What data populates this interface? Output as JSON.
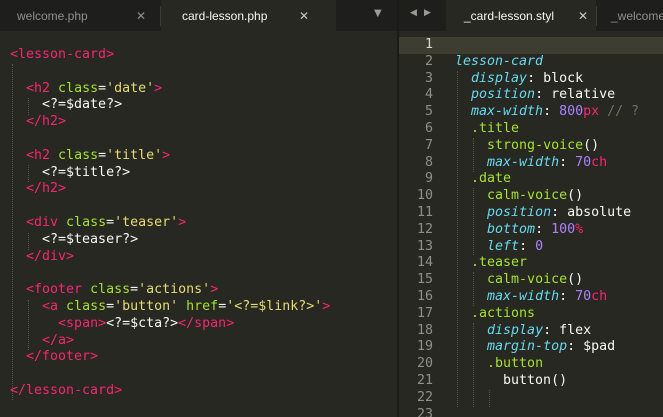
{
  "left_group": {
    "tabs": [
      {
        "label": "welcome.php",
        "close": "✕",
        "active": false
      },
      {
        "label": "card-lesson.php",
        "close": "✕",
        "active": true
      }
    ],
    "dropdown_glyph": "▼"
  },
  "right_group": {
    "nav_prev": "◀",
    "nav_next": "▶",
    "tabs": [
      {
        "label": "_card-lesson.styl",
        "close": "✕",
        "active": true
      },
      {
        "label": "_welcome",
        "active": false
      }
    ]
  },
  "colors": {
    "background": "#272822",
    "tab_bar": "#1e1f1c",
    "tag": "#f92672",
    "attribute": "#a6e22e",
    "string": "#e6db74",
    "property": "#66d9ef",
    "number": "#ae81ff",
    "comment": "#75715e",
    "text": "#f8f8f2"
  },
  "php_editor": {
    "lines": [
      [
        {
          "t": "<lesson-card>",
          "c": "tag"
        }
      ],
      [],
      [
        {
          "t": "  "
        },
        {
          "t": "<h2",
          "c": "tag"
        },
        {
          "t": " class",
          "c": "attr"
        },
        {
          "t": "="
        },
        {
          "t": "'date'",
          "c": "str"
        },
        {
          "t": ">",
          "c": "tag"
        }
      ],
      [
        {
          "t": "    <?=$date?>"
        }
      ],
      [
        {
          "t": "  "
        },
        {
          "t": "</h2>",
          "c": "tag"
        }
      ],
      [],
      [
        {
          "t": "  "
        },
        {
          "t": "<h2",
          "c": "tag"
        },
        {
          "t": " class",
          "c": "attr"
        },
        {
          "t": "="
        },
        {
          "t": "'title'",
          "c": "str"
        },
        {
          "t": ">",
          "c": "tag"
        }
      ],
      [
        {
          "t": "    <?=$title?>"
        }
      ],
      [
        {
          "t": "  "
        },
        {
          "t": "</h2>",
          "c": "tag"
        }
      ],
      [],
      [
        {
          "t": "  "
        },
        {
          "t": "<div",
          "c": "tag"
        },
        {
          "t": " class",
          "c": "attr"
        },
        {
          "t": "="
        },
        {
          "t": "'teaser'",
          "c": "str"
        },
        {
          "t": ">",
          "c": "tag"
        }
      ],
      [
        {
          "t": "    <?=$teaser?>"
        }
      ],
      [
        {
          "t": "  "
        },
        {
          "t": "</div>",
          "c": "tag"
        }
      ],
      [],
      [
        {
          "t": "  "
        },
        {
          "t": "<footer",
          "c": "tag"
        },
        {
          "t": " class",
          "c": "attr"
        },
        {
          "t": "="
        },
        {
          "t": "'actions'",
          "c": "str"
        },
        {
          "t": ">",
          "c": "tag"
        }
      ],
      [
        {
          "t": "    "
        },
        {
          "t": "<a",
          "c": "tag"
        },
        {
          "t": " class",
          "c": "attr"
        },
        {
          "t": "="
        },
        {
          "t": "'button'",
          "c": "str"
        },
        {
          "t": " href",
          "c": "attr"
        },
        {
          "t": "="
        },
        {
          "t": "'<?=$link?>'",
          "c": "str"
        },
        {
          "t": ">",
          "c": "tag"
        }
      ],
      [
        {
          "t": "      "
        },
        {
          "t": "<span>",
          "c": "tag"
        },
        {
          "t": "<?=$cta?>"
        },
        {
          "t": "</span>",
          "c": "tag"
        }
      ],
      [
        {
          "t": "    "
        },
        {
          "t": "</a>",
          "c": "tag"
        }
      ],
      [
        {
          "t": "  "
        },
        {
          "t": "</footer>",
          "c": "tag"
        }
      ],
      [],
      [
        {
          "t": "</lesson-card>",
          "c": "tag"
        }
      ]
    ]
  },
  "styl_editor": {
    "line_numbers": [
      "1",
      "2",
      "3",
      "4",
      "5",
      "6",
      "7",
      "8",
      "9",
      "10",
      "11",
      "12",
      "13",
      "14",
      "15",
      "16",
      "17",
      "18",
      "19",
      "20",
      "21",
      "22",
      "23"
    ],
    "current_line": 1,
    "lines": [
      [],
      [
        {
          "t": "lesson-card",
          "c": "sel"
        }
      ],
      [
        {
          "t": "  "
        },
        {
          "t": "display",
          "c": "prop"
        },
        {
          "t": ": block"
        }
      ],
      [
        {
          "t": "  "
        },
        {
          "t": "position",
          "c": "prop"
        },
        {
          "t": ": relative"
        }
      ],
      [
        {
          "t": "  "
        },
        {
          "t": "max-width",
          "c": "prop"
        },
        {
          "t": ": "
        },
        {
          "t": "800",
          "c": "num"
        },
        {
          "t": "px",
          "c": "unit"
        },
        {
          "t": " // ?",
          "c": "cmt"
        }
      ],
      [
        {
          "t": "  "
        },
        {
          "t": ".title",
          "c": "cls"
        }
      ],
      [
        {
          "t": "    "
        },
        {
          "t": "strong-voice",
          "c": "fn"
        },
        {
          "t": "()"
        }
      ],
      [
        {
          "t": "    "
        },
        {
          "t": "max-width",
          "c": "prop"
        },
        {
          "t": ": "
        },
        {
          "t": "70",
          "c": "num"
        },
        {
          "t": "ch",
          "c": "unit"
        }
      ],
      [
        {
          "t": "  "
        },
        {
          "t": ".date",
          "c": "cls"
        }
      ],
      [
        {
          "t": "    "
        },
        {
          "t": "calm-voice",
          "c": "fn"
        },
        {
          "t": "()"
        }
      ],
      [
        {
          "t": "    "
        },
        {
          "t": "position",
          "c": "prop"
        },
        {
          "t": ": absolute"
        }
      ],
      [
        {
          "t": "    "
        },
        {
          "t": "bottom",
          "c": "prop"
        },
        {
          "t": ": "
        },
        {
          "t": "100",
          "c": "num"
        },
        {
          "t": "%",
          "c": "unit"
        }
      ],
      [
        {
          "t": "    "
        },
        {
          "t": "left",
          "c": "prop"
        },
        {
          "t": ": "
        },
        {
          "t": "0",
          "c": "num"
        }
      ],
      [
        {
          "t": "  "
        },
        {
          "t": ".teaser",
          "c": "cls"
        }
      ],
      [
        {
          "t": "    "
        },
        {
          "t": "calm-voice",
          "c": "fn"
        },
        {
          "t": "()"
        }
      ],
      [
        {
          "t": "    "
        },
        {
          "t": "max-width",
          "c": "prop"
        },
        {
          "t": ": "
        },
        {
          "t": "70",
          "c": "num"
        },
        {
          "t": "ch",
          "c": "unit"
        }
      ],
      [
        {
          "t": "  "
        },
        {
          "t": ".actions",
          "c": "cls"
        }
      ],
      [
        {
          "t": "    "
        },
        {
          "t": "display",
          "c": "prop"
        },
        {
          "t": ": flex"
        }
      ],
      [
        {
          "t": "    "
        },
        {
          "t": "margin-top",
          "c": "prop"
        },
        {
          "t": ": $pad"
        }
      ],
      [
        {
          "t": "    "
        },
        {
          "t": ".button",
          "c": "cls"
        }
      ],
      [
        {
          "t": "      button()"
        }
      ],
      [],
      []
    ]
  }
}
